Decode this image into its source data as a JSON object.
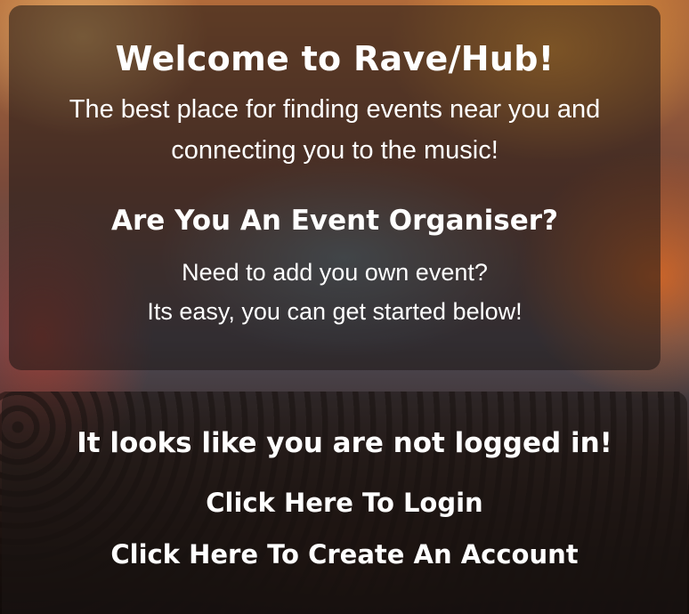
{
  "welcome": {
    "title": "Welcome to Rave/Hub!",
    "line1": "The best place for finding events near you and",
    "line2": "connecting you to the music!"
  },
  "organiser": {
    "title": "Are You An Event Organiser?",
    "line1": "Need to add you own event?",
    "line2": "Its easy, you can get started below!"
  },
  "auth": {
    "status": "It looks like you are not logged in!",
    "login_link": "Click Here To Login",
    "create_account_link": "Click Here To Create An Account"
  }
}
